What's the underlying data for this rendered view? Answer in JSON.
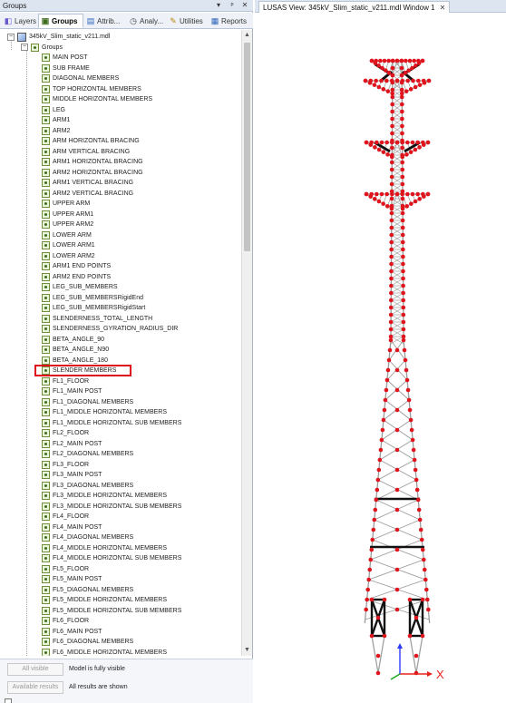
{
  "panel": {
    "title": "Groups",
    "dropdown_icon": "dropdown-arrow-icon",
    "pin_icon": "pin-icon",
    "close_icon": "close-icon"
  },
  "tabs": [
    {
      "label": "Layers",
      "icon": "layers-icon",
      "active": false
    },
    {
      "label": "Groups",
      "icon": "groups-icon",
      "active": true
    },
    {
      "label": "Attrib...",
      "icon": "attributes-icon",
      "active": false
    },
    {
      "label": "Analy...",
      "icon": "analyses-icon",
      "active": false
    },
    {
      "label": "Utilities",
      "icon": "utilities-icon",
      "active": false
    },
    {
      "label": "Reports",
      "icon": "reports-icon",
      "active": false
    }
  ],
  "tree": {
    "root_label": "345kV_Slim_static_v211.mdl",
    "groups_label": "Groups",
    "items": [
      "MAIN POST",
      "SUB FRAME",
      "DIAGONAL MEMBERS",
      "TOP HORIZONTAL MEMBERS",
      "MIDDLE HORIZONTAL MEMBERS",
      "LEG",
      "ARM1",
      "ARM2",
      "ARM HORIZONTAL BRACING",
      "ARM VERTICAL BRACING",
      "ARM1 HORIZONTAL BRACING",
      "ARM2 HORIZONTAL BRACING",
      "ARM1 VERTICAL BRACING",
      "ARM2 VERTICAL BRACING",
      "UPPER ARM",
      "UPPER ARM1",
      "UPPER ARM2",
      "LOWER ARM",
      "LOWER ARM1",
      "LOWER ARM2",
      "ARM1 END POINTS",
      "ARM2 END POINTS",
      "LEG_SUB_MEMBERS",
      "LEG_SUB_MEMBERSRigidEnd",
      "LEG_SUB_MEMBERSRigidStart",
      "SLENDERNESS_TOTAL_LENGTH",
      "SLENDERNESS_GYRATION_RADIUS_DIR",
      "BETA_ANGLE_90",
      "BETA_ANGLE_N90",
      "BETA_ANGLE_180",
      "SLENDER MEMBERS",
      "FL1_FLOOR",
      "FL1_MAIN POST",
      "FL1_DIAGONAL MEMBERS",
      "FL1_MIDDLE HORIZONTAL MEMBERS",
      "FL1_MIDDLE HORIZONTAL SUB MEMBERS",
      "FL2_FLOOR",
      "FL2_MAIN POST",
      "FL2_DIAGONAL MEMBERS",
      "FL3_FLOOR",
      "FL3_MAIN POST",
      "FL3_DIAGONAL MEMBERS",
      "FL3_MIDDLE HORIZONTAL MEMBERS",
      "FL3_MIDDLE HORIZONTAL SUB MEMBERS",
      "FL4_FLOOR",
      "FL4_MAIN POST",
      "FL4_DIAGONAL MEMBERS",
      "FL4_MIDDLE HORIZONTAL MEMBERS",
      "FL4_MIDDLE HORIZONTAL SUB MEMBERS",
      "FL5_FLOOR",
      "FL5_MAIN POST",
      "FL5_DIAGONAL MEMBERS",
      "FL5_MIDDLE HORIZONTAL MEMBERS",
      "FL5_MIDDLE HORIZONTAL SUB MEMBERS",
      "FL6_FLOOR",
      "FL6_MAIN POST",
      "FL6_DIAGONAL MEMBERS",
      "FL6_MIDDLE HORIZONTAL MEMBERS"
    ],
    "highlighted_item": "SLENDER MEMBERS",
    "highlight_color": "#e0101a"
  },
  "status": {
    "all_visible_button": "All visible",
    "visible_message": "Model is fully visible",
    "available_results_button": "Available results",
    "results_message": "All results are shown"
  },
  "view": {
    "title": "LUSAS View: 345kV_Slim_static_v211.mdl Window 1",
    "close_icon": "close-icon",
    "axis_x_label": "X",
    "axis_x_color": "#e8231c",
    "axis_y_color": "#18a81a",
    "axis_z_color": "#2c3cff",
    "node_color": "#e0141c",
    "member_color": "#9a9a9a"
  }
}
